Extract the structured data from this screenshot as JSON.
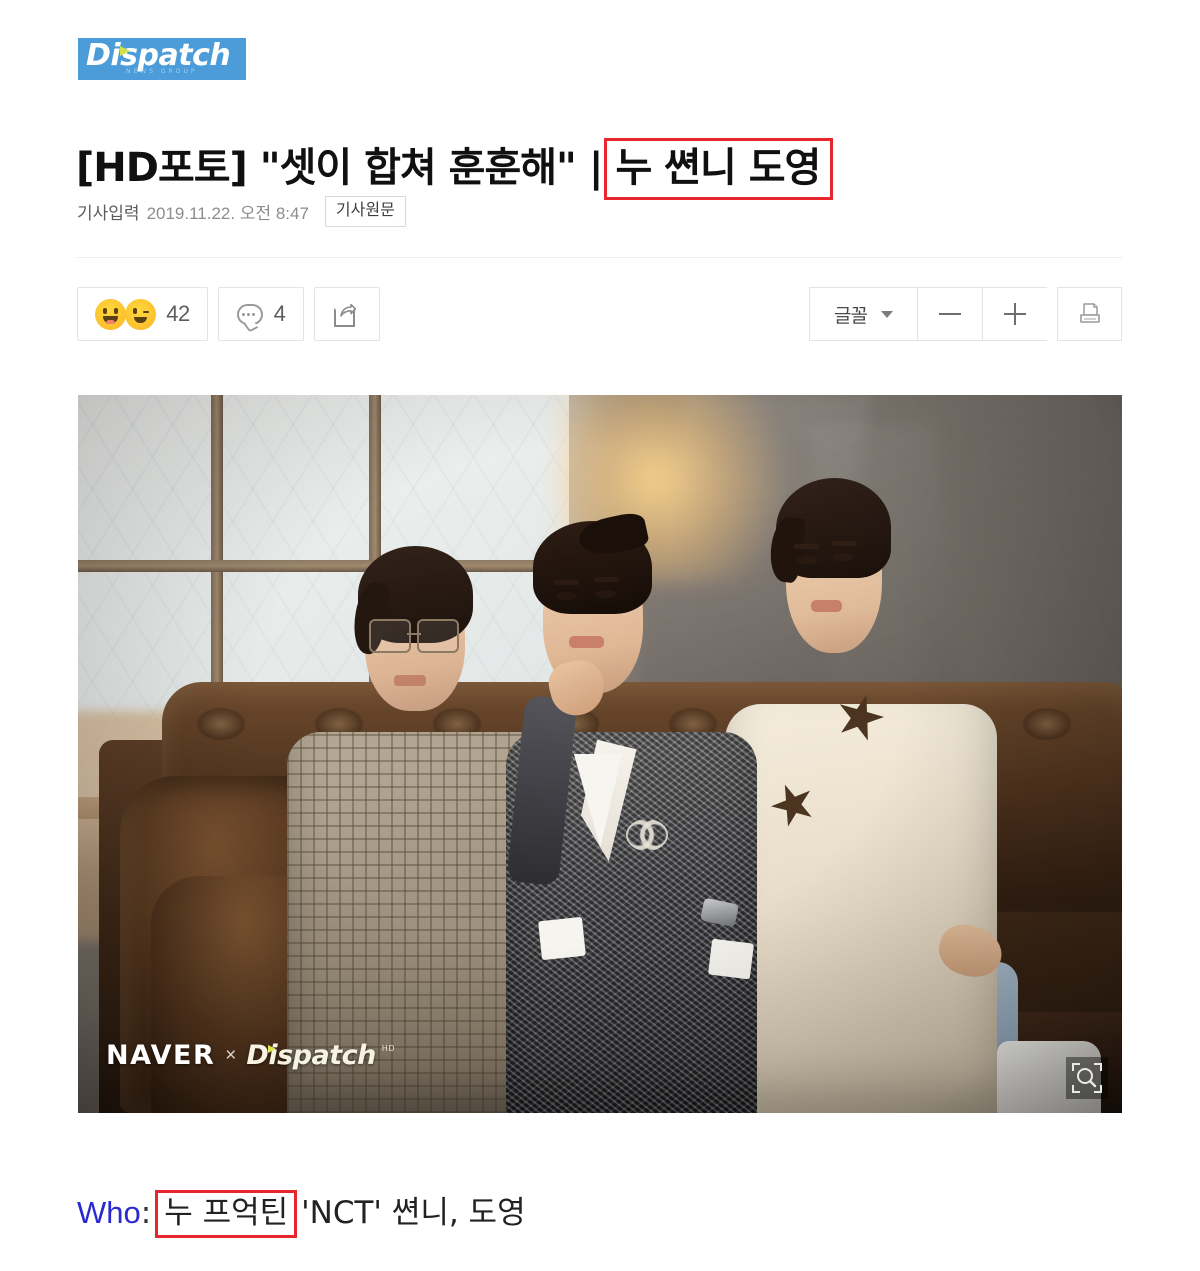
{
  "press": {
    "name": "Dispatch",
    "subtitle": "NEWS GROUP",
    "brand_color": "#4b9cd8"
  },
  "article": {
    "title_prefix": "[HD포토] \"셋이 합쳐 훈훈해\" |",
    "title_highlight": "누 쎤니 도영",
    "byline_label": "기사입력",
    "byline_date": "2019.11.22. 오전 8:47",
    "original_button": "기사원문",
    "highlight_color": "#e8262d"
  },
  "toolbar": {
    "reaction_count": "42",
    "comment_count": "4",
    "share_label": "share-icon",
    "font_label": "글꼴",
    "decrease_label": "—",
    "increase_label": "+",
    "print_label": "print-icon"
  },
  "photo": {
    "watermark_naver": "NAVER",
    "watermark_x": "×",
    "watermark_dispatch": "Dispatch",
    "watermark_sup": "HD",
    "zoom_label": "zoom-icon"
  },
  "caption": {
    "who_label": "Who",
    "colon": ":",
    "highlight": "누 프억틴",
    "rest": "'NCT' 쎤니, 도영"
  }
}
